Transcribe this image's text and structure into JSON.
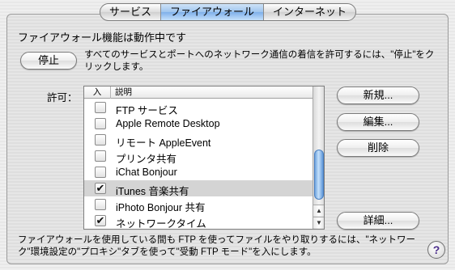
{
  "tabs": [
    "サービス",
    "ファイアウォール",
    "インターネット"
  ],
  "active_tab": 1,
  "heading": "ファイアウォール機能は動作中です",
  "stop_button": "停止",
  "stop_description": "すべてのサービスとポートへのネットワーク通信の着信を許可するには、\"停止\"をクリックします。",
  "allow_label": "許可：",
  "list": {
    "col_in": "入",
    "col_desc": "説明",
    "rows": [
      {
        "label": "FTP サービス",
        "checked": false
      },
      {
        "label": "Apple Remote Desktop",
        "checked": false
      },
      {
        "label": "リモート AppleEvent",
        "checked": false
      },
      {
        "label": "プリンタ共有",
        "checked": false
      },
      {
        "label": "iChat Bonjour",
        "checked": false
      },
      {
        "label": "iTunes 音楽共有",
        "checked": true,
        "selected": true
      },
      {
        "label": "iPhoto Bonjour 共有",
        "checked": false
      },
      {
        "label": "ネットワークタイム",
        "checked": true
      }
    ]
  },
  "buttons": {
    "new": "新規...",
    "edit": "編集...",
    "delete": "削除",
    "advanced": "詳細..."
  },
  "footer": "ファイアウォールを使用している間も FTP を使ってファイルをやり取りするには、\"ネットワーク\"環境設定の\"プロキシ\"タブを使って\"受動 FTP モード\"を入にします。",
  "help_glyph": "?",
  "check_glyph": "✔",
  "scroll_up_glyph": "▲",
  "scroll_down_glyph": "▼"
}
